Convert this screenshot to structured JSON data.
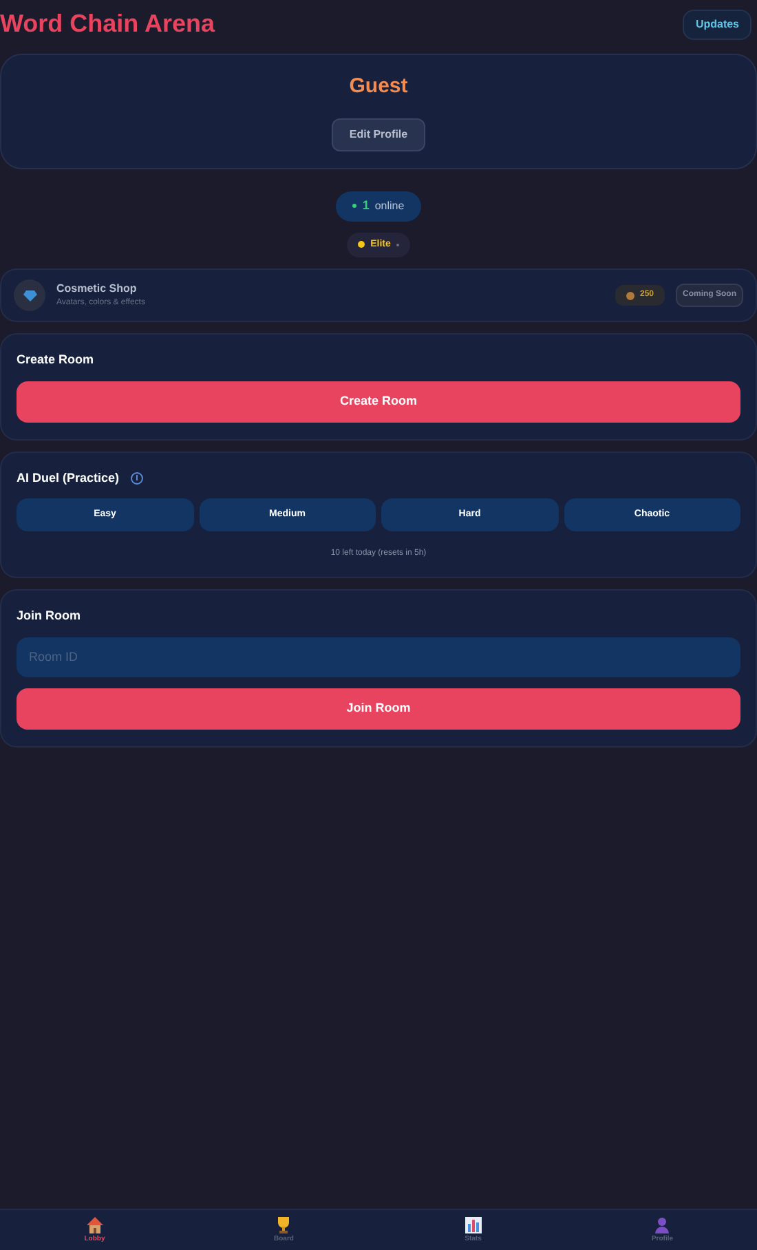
{
  "header": {
    "title": "Word Chain Arena",
    "updates_button": "Updates"
  },
  "profile": {
    "name": "Guest",
    "edit_button": "Edit Profile"
  },
  "online": {
    "count": "1",
    "label": "online"
  },
  "rank": {
    "label": "Elite"
  },
  "shop": {
    "title": "Cosmetic Shop",
    "subtitle": "Avatars, colors & effects",
    "coins": "250",
    "badge": "Coming Soon"
  },
  "create_room": {
    "title": "Create Room",
    "button": "Create Room"
  },
  "ai_duel": {
    "title": "AI Duel (Practice)",
    "difficulties": [
      "Easy",
      "Medium",
      "Hard",
      "Chaotic"
    ],
    "note": "10 left today (resets in 5h)"
  },
  "join_room": {
    "title": "Join Room",
    "placeholder": "Room ID",
    "button": "Join Room"
  },
  "nav": [
    {
      "kind": "house",
      "label": "Lobby",
      "selected": true
    },
    {
      "kind": "trophy",
      "label": "Board",
      "selected": false
    },
    {
      "kind": "chart",
      "label": "Stats",
      "selected": false
    },
    {
      "kind": "person",
      "label": "Profile",
      "selected": false
    }
  ]
}
